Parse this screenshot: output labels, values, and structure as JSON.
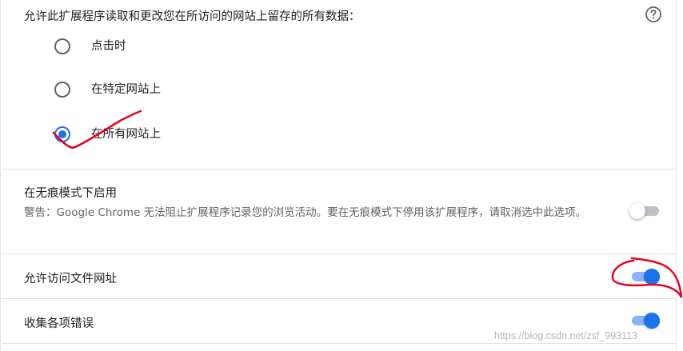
{
  "site_access": {
    "title": "允许此扩展程序读取和更改您在所访问的网站上留存的所有数据：",
    "help_icon": "help-circle-icon",
    "options": [
      {
        "label": "点击时",
        "checked": false
      },
      {
        "label": "在特定网站上",
        "checked": false
      },
      {
        "label": "在所有网站上",
        "checked": true
      }
    ]
  },
  "incognito": {
    "title": "在无痕模式下启用",
    "warning": "警告：Google Chrome 无法阻止扩展程序记录您的浏览活动。要在无痕模式下停用该扩展程序，请取消选中此选项。",
    "enabled": false
  },
  "file_urls": {
    "title": "允许访问文件网址",
    "enabled": true
  },
  "collect_errors": {
    "title": "收集各项错误",
    "enabled": true
  },
  "watermark": "https://blog.csdn.net/zsf_993113",
  "colors": {
    "accent": "#1a73e8",
    "annotation": "#e8001c"
  }
}
